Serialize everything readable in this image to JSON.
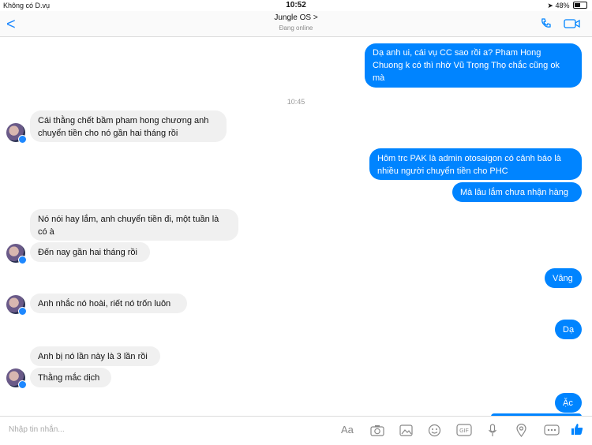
{
  "status": {
    "carrier": "Không có D.vụ",
    "time": "10:52",
    "battery": "48%"
  },
  "nav": {
    "back": "<",
    "title": "Jungle OS >",
    "subtitle": "Đang online"
  },
  "time_separator": "10:45",
  "messages": {
    "m1": "Dạ anh ui, cái vụ CC sao rồi a? Pham Hong",
    "m1b": "Chuong k có thì nhờ Vũ Trọng Thọ chắc cũng ok",
    "m1c": "mà",
    "m2": "Cái thằng chết bầm pham hong chương anh",
    "m2b": "chuyển tiền cho nó gần hai tháng rồi",
    "m3": "Hôm trc PAK là admin otosaigon có cảnh báo là",
    "m3b": "nhiều người chuyển tiền cho PHC",
    "m4": "Mà lâu lắm chưa nhận hàng",
    "m5": "Nó nói hay lắm, anh chuyển tiền đi, một tuần là",
    "m5b": "có à",
    "m6": "Đến nay gần hai tháng rồi",
    "m7": "Vâng",
    "m8": "Anh nhắc nó hoài, riết nó trốn luôn",
    "m9": "Dạ",
    "m10": "Anh bị nó lần này là 3 lần rồi",
    "m11": "Thằng mắc dịch",
    "m12": "Ặc"
  },
  "composer": {
    "placeholder": "Nhập tin nhắn...",
    "aa": "Aa"
  },
  "colors": {
    "accent": "#0084ff",
    "incoming": "#f0f0f0"
  },
  "icons": [
    "camera-icon",
    "photo-icon",
    "emoji-icon",
    "gif-icon",
    "mic-icon",
    "location-icon",
    "more-icon",
    "like-icon"
  ]
}
